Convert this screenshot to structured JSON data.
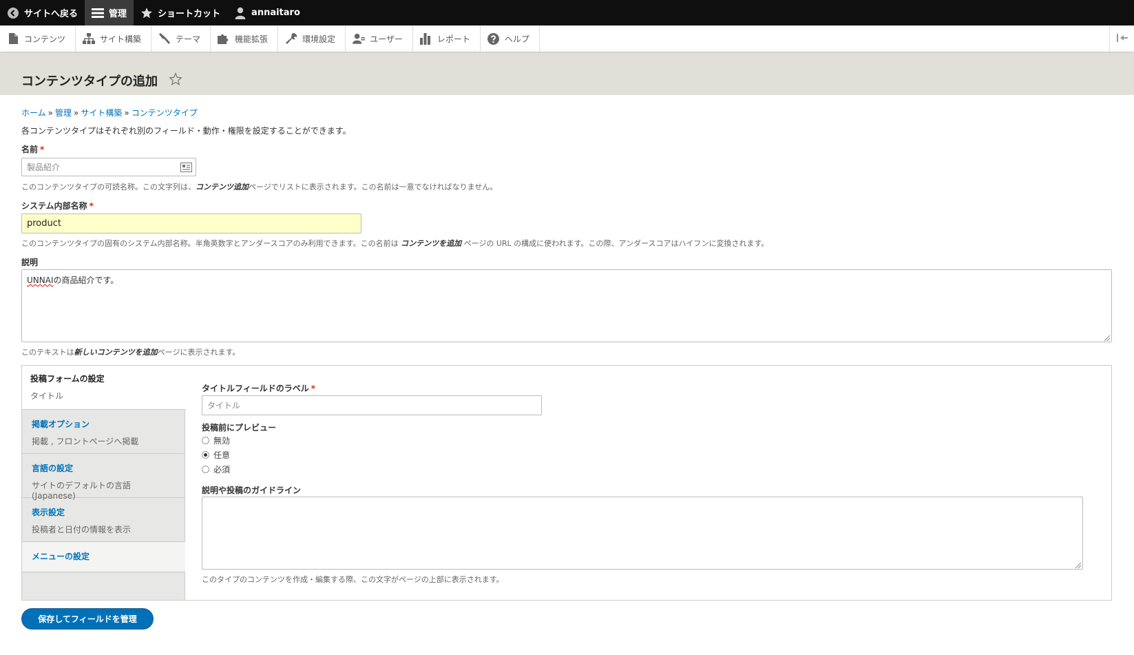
{
  "toolbar": {
    "back": "サイトへ戻る",
    "manage": "管理",
    "shortcuts": "ショートカット",
    "user": "annaitaro"
  },
  "tray": {
    "items": [
      "コンテンツ",
      "サイト構築",
      "テーマ",
      "機能拡張",
      "環境設定",
      "ユーザー",
      "レポート",
      "ヘルプ"
    ]
  },
  "page": {
    "title": "コンテンツタイプの追加"
  },
  "breadcrumb": {
    "items": [
      "ホーム",
      "管理",
      "サイト構築",
      "コンテンツタイプ"
    ],
    "sep": "»"
  },
  "intro": "各コンテンツタイプはそれぞれ別のフィールド・動作・権限を設定することができます。",
  "name_field": {
    "label": "名前",
    "required": "*",
    "value": "製品紹介",
    "desc_pre": "このコンテンツタイプの可読名称。この文字列は、",
    "desc_em": "コンテンツ追加",
    "desc_post": "ページでリストに表示されます。この名前は一意でなければなりません。"
  },
  "machine_field": {
    "label": "システム内部名称",
    "required": "*",
    "value": "product",
    "desc_pre": "このコンテンツタイプの固有のシステム内部名称。半角英数字とアンダースコアのみ利用できます。この名前は",
    "desc_em": "コンテンツを追加",
    "desc_post": "ページの URL の構成に使われます。この際、アンダースコアはハイフンに変換されます。"
  },
  "description_field": {
    "label": "説明",
    "value_spell": "UNNAI",
    "value_rest": "の商品紹介です。",
    "desc_pre": "このテキストは",
    "desc_em": "新しいコンテンツを追加",
    "desc_post": "ページに表示されます。"
  },
  "vtabs": [
    {
      "title": "投稿フォームの設定",
      "summary": "タイトル"
    },
    {
      "title": "掲載オプション",
      "summary": "掲載 , フロントページへ掲載"
    },
    {
      "title": "言語の設定",
      "summary": "サイトのデフォルトの言語 (Japanese)"
    },
    {
      "title": "表示設定",
      "summary": "投稿者と日付の情報を表示"
    },
    {
      "title": "メニューの設定",
      "summary": ""
    }
  ],
  "submission": {
    "title_label": "タイトルフィールドのラベル",
    "required": "*",
    "title_value": "タイトル",
    "preview_label": "投稿前にプレビュー",
    "preview_options": [
      "無効",
      "任意",
      "必須"
    ],
    "preview_selected": "任意",
    "help_label": "説明や投稿のガイドライン",
    "help_desc": "このタイプのコンテンツを作成・編集する際、この文字がページの上部に表示されます。"
  },
  "save_button": "保存してフィールドを管理"
}
